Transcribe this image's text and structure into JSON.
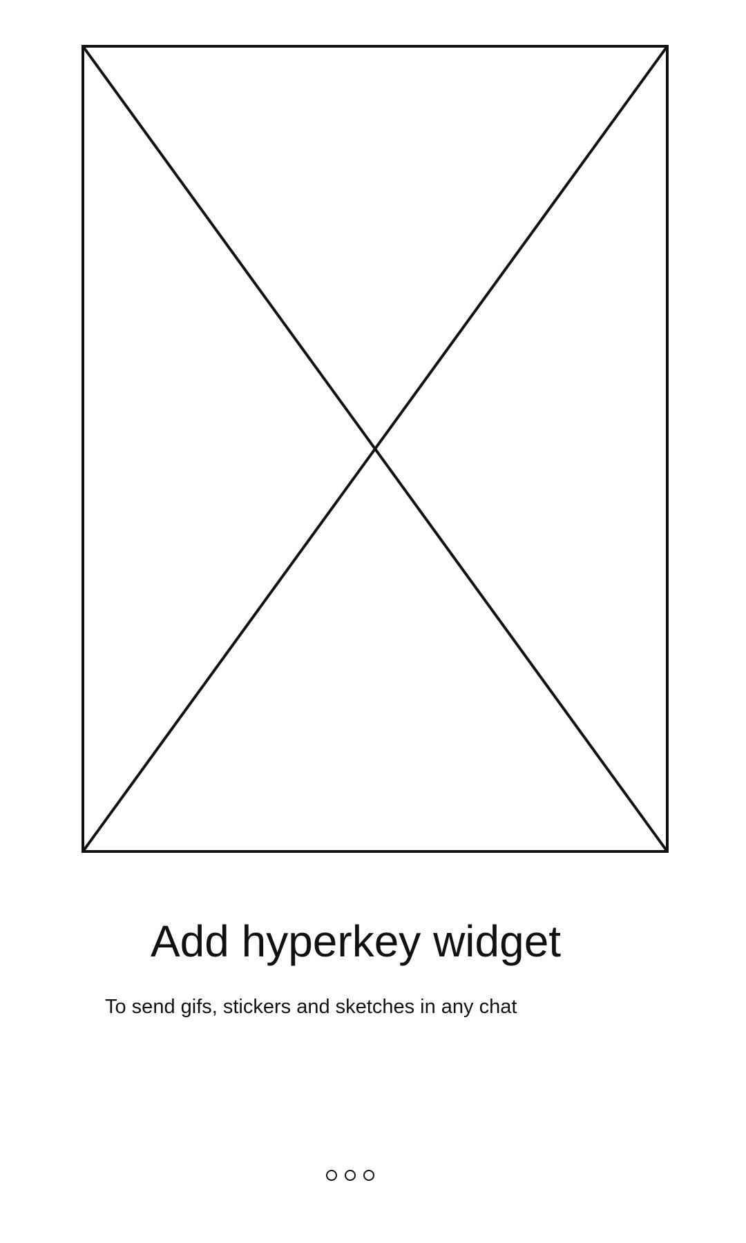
{
  "onboarding": {
    "title": "Add hyperkey widget",
    "subtitle": "To send gifs, stickers and sketches in any chat",
    "hero_image_icon": "image-placeholder-icon",
    "pager": {
      "count": 3,
      "current": 1
    }
  },
  "colors": {
    "background": "#ffffff",
    "text": "#111111",
    "stroke": "#111111"
  }
}
